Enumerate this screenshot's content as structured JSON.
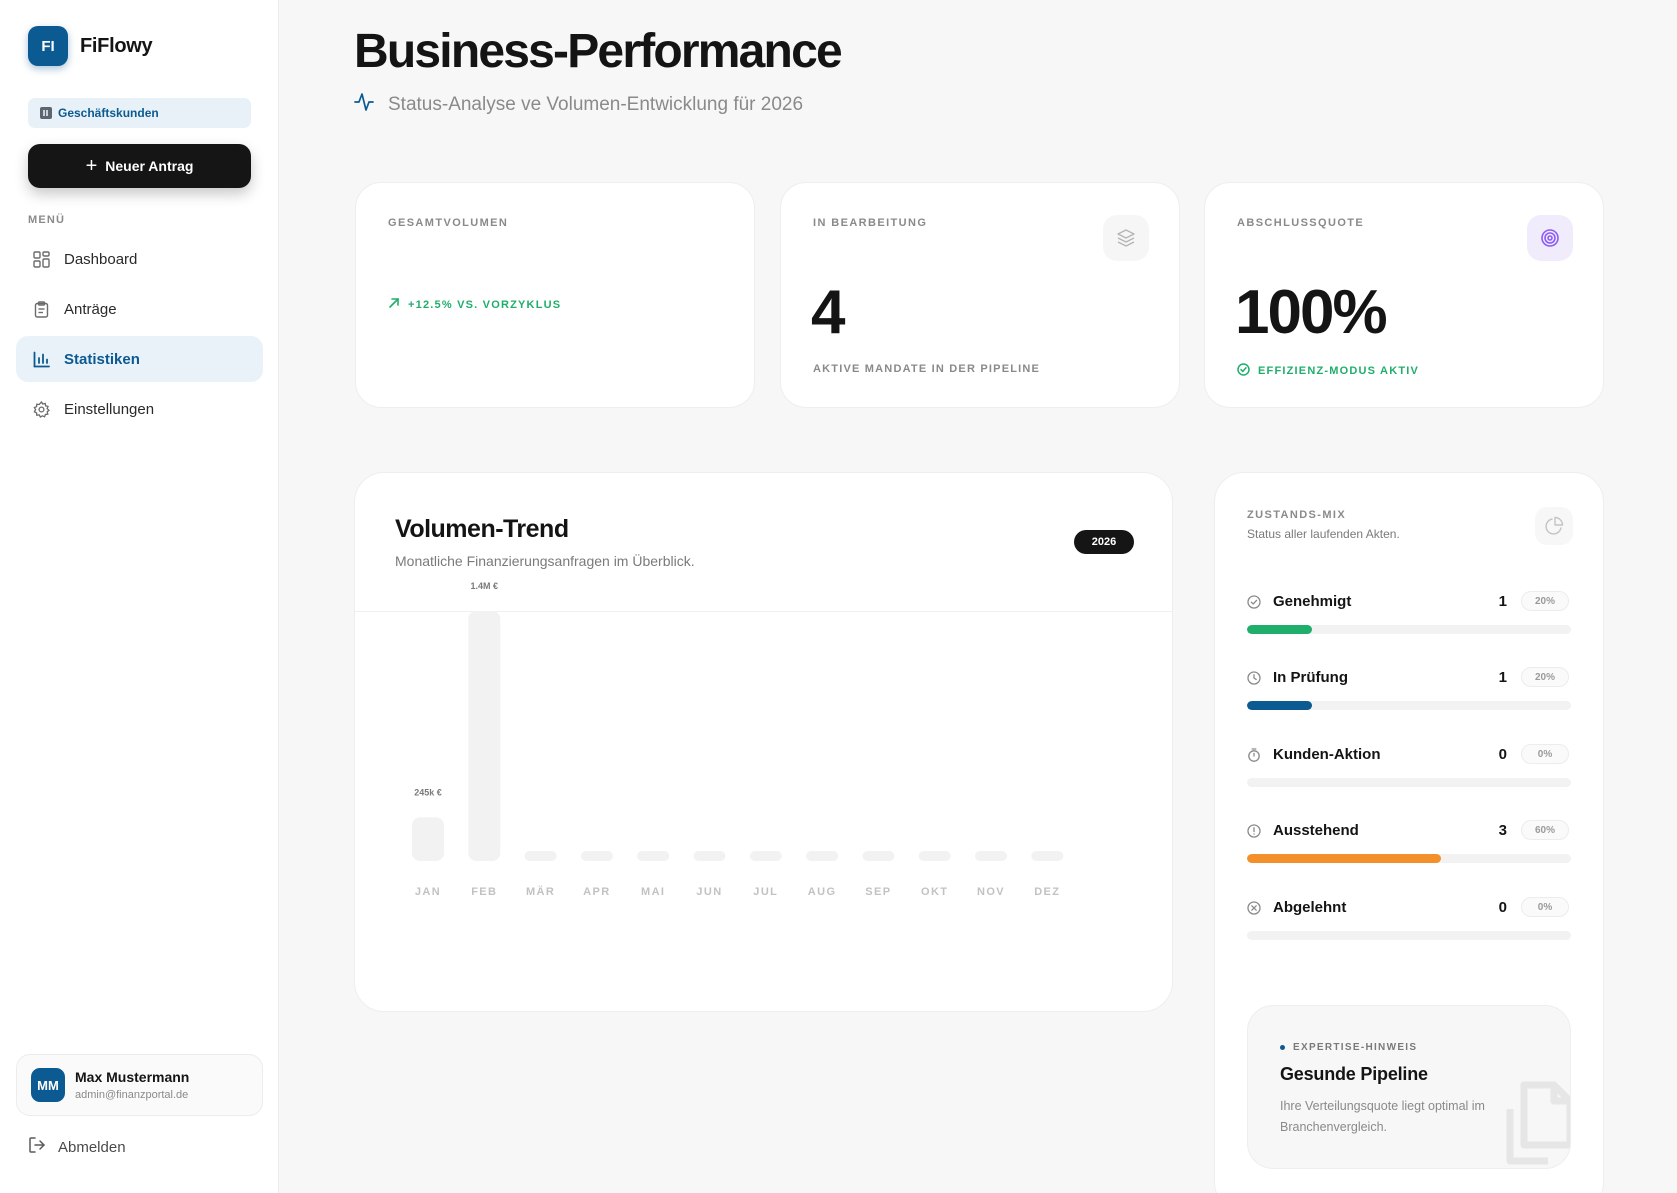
{
  "brand": {
    "logo_text": "FI",
    "name": "FiFlowy"
  },
  "sidebar": {
    "segment": "Geschäftskunden",
    "new_button": "Neuer Antrag",
    "menu_label": "MENÜ",
    "items": [
      {
        "label": "Dashboard",
        "icon": "grid-icon"
      },
      {
        "label": "Anträge",
        "icon": "clipboard-icon"
      },
      {
        "label": "Statistiken",
        "icon": "bar-chart-icon",
        "active": true
      },
      {
        "label": "Einstellungen",
        "icon": "gear-icon"
      }
    ],
    "user": {
      "initials": "MM",
      "name": "Max Mustermann",
      "email": "admin@finanzportal.de"
    },
    "logout": "Abmelden"
  },
  "header": {
    "title": "Business-Performance",
    "subtitle": "Status-Analyse ve Volumen-Entwicklung für 2026"
  },
  "kpis": [
    {
      "label": "GESAMTVOLUMEN",
      "value": "",
      "foot": "+12.5% VS. VORZYKLUS",
      "foot_color": "#1fae6b"
    },
    {
      "label": "IN BEARBEITUNG",
      "value": "4",
      "foot": "AKTIVE MANDATE IN DER PIPELINE",
      "foot_color": "#8a8a8a"
    },
    {
      "label": "ABSCHLUSSQUOTE",
      "value": "100%",
      "foot": "EFFIZIENZ-MODUS AKTIV",
      "foot_color": "#1fae6b"
    }
  ],
  "trend": {
    "title": "Volumen-Trend",
    "subtitle": "Monatliche Finanzierungsanfragen im Überblick.",
    "year": "2026"
  },
  "chart_data": {
    "type": "bar",
    "categories": [
      "JAN",
      "FEB",
      "MÄR",
      "APR",
      "MAI",
      "JUN",
      "JUL",
      "AUG",
      "SEP",
      "OKT",
      "NOV",
      "DEZ"
    ],
    "values": [
      245000,
      1400000,
      0,
      0,
      0,
      0,
      0,
      0,
      0,
      0,
      0,
      0
    ],
    "data_labels": [
      "245k €",
      "1.4M €",
      "",
      "",
      "",
      "",
      "",
      "",
      "",
      "",
      "",
      ""
    ],
    "title": "",
    "xlabel": "",
    "ylabel": "",
    "ylim": [
      0,
      1400000
    ],
    "grid": false
  },
  "status_mix": {
    "label": "ZUSTANDS-MIX",
    "subtitle": "Status aller laufenden Akten.",
    "rows": [
      {
        "name": "Genehmigt",
        "count": "1",
        "percent": "20%",
        "fraction": 0.2,
        "color": "#1fae6b",
        "icon": "check-circle-icon"
      },
      {
        "name": "In Prüfung",
        "count": "1",
        "percent": "20%",
        "fraction": 0.2,
        "color": "#0c5a92",
        "icon": "clock-icon"
      },
      {
        "name": "Kunden-Aktion",
        "count": "0",
        "percent": "0%",
        "fraction": 0,
        "color": "#8a8a8a",
        "icon": "stopwatch-icon"
      },
      {
        "name": "Ausstehend",
        "count": "3",
        "percent": "60%",
        "fraction": 0.6,
        "color": "#f3902c",
        "icon": "alert-circle-icon"
      },
      {
        "name": "Abgelehnt",
        "count": "0",
        "percent": "0%",
        "fraction": 0,
        "color": "#8a8a8a",
        "icon": "x-circle-icon"
      }
    ]
  },
  "tip": {
    "label": "EXPERTISE-HINWEIS",
    "title": "Gesunde Pipeline",
    "text": "Ihre Verteilungsquote liegt optimal im Branchenvergleich."
  }
}
